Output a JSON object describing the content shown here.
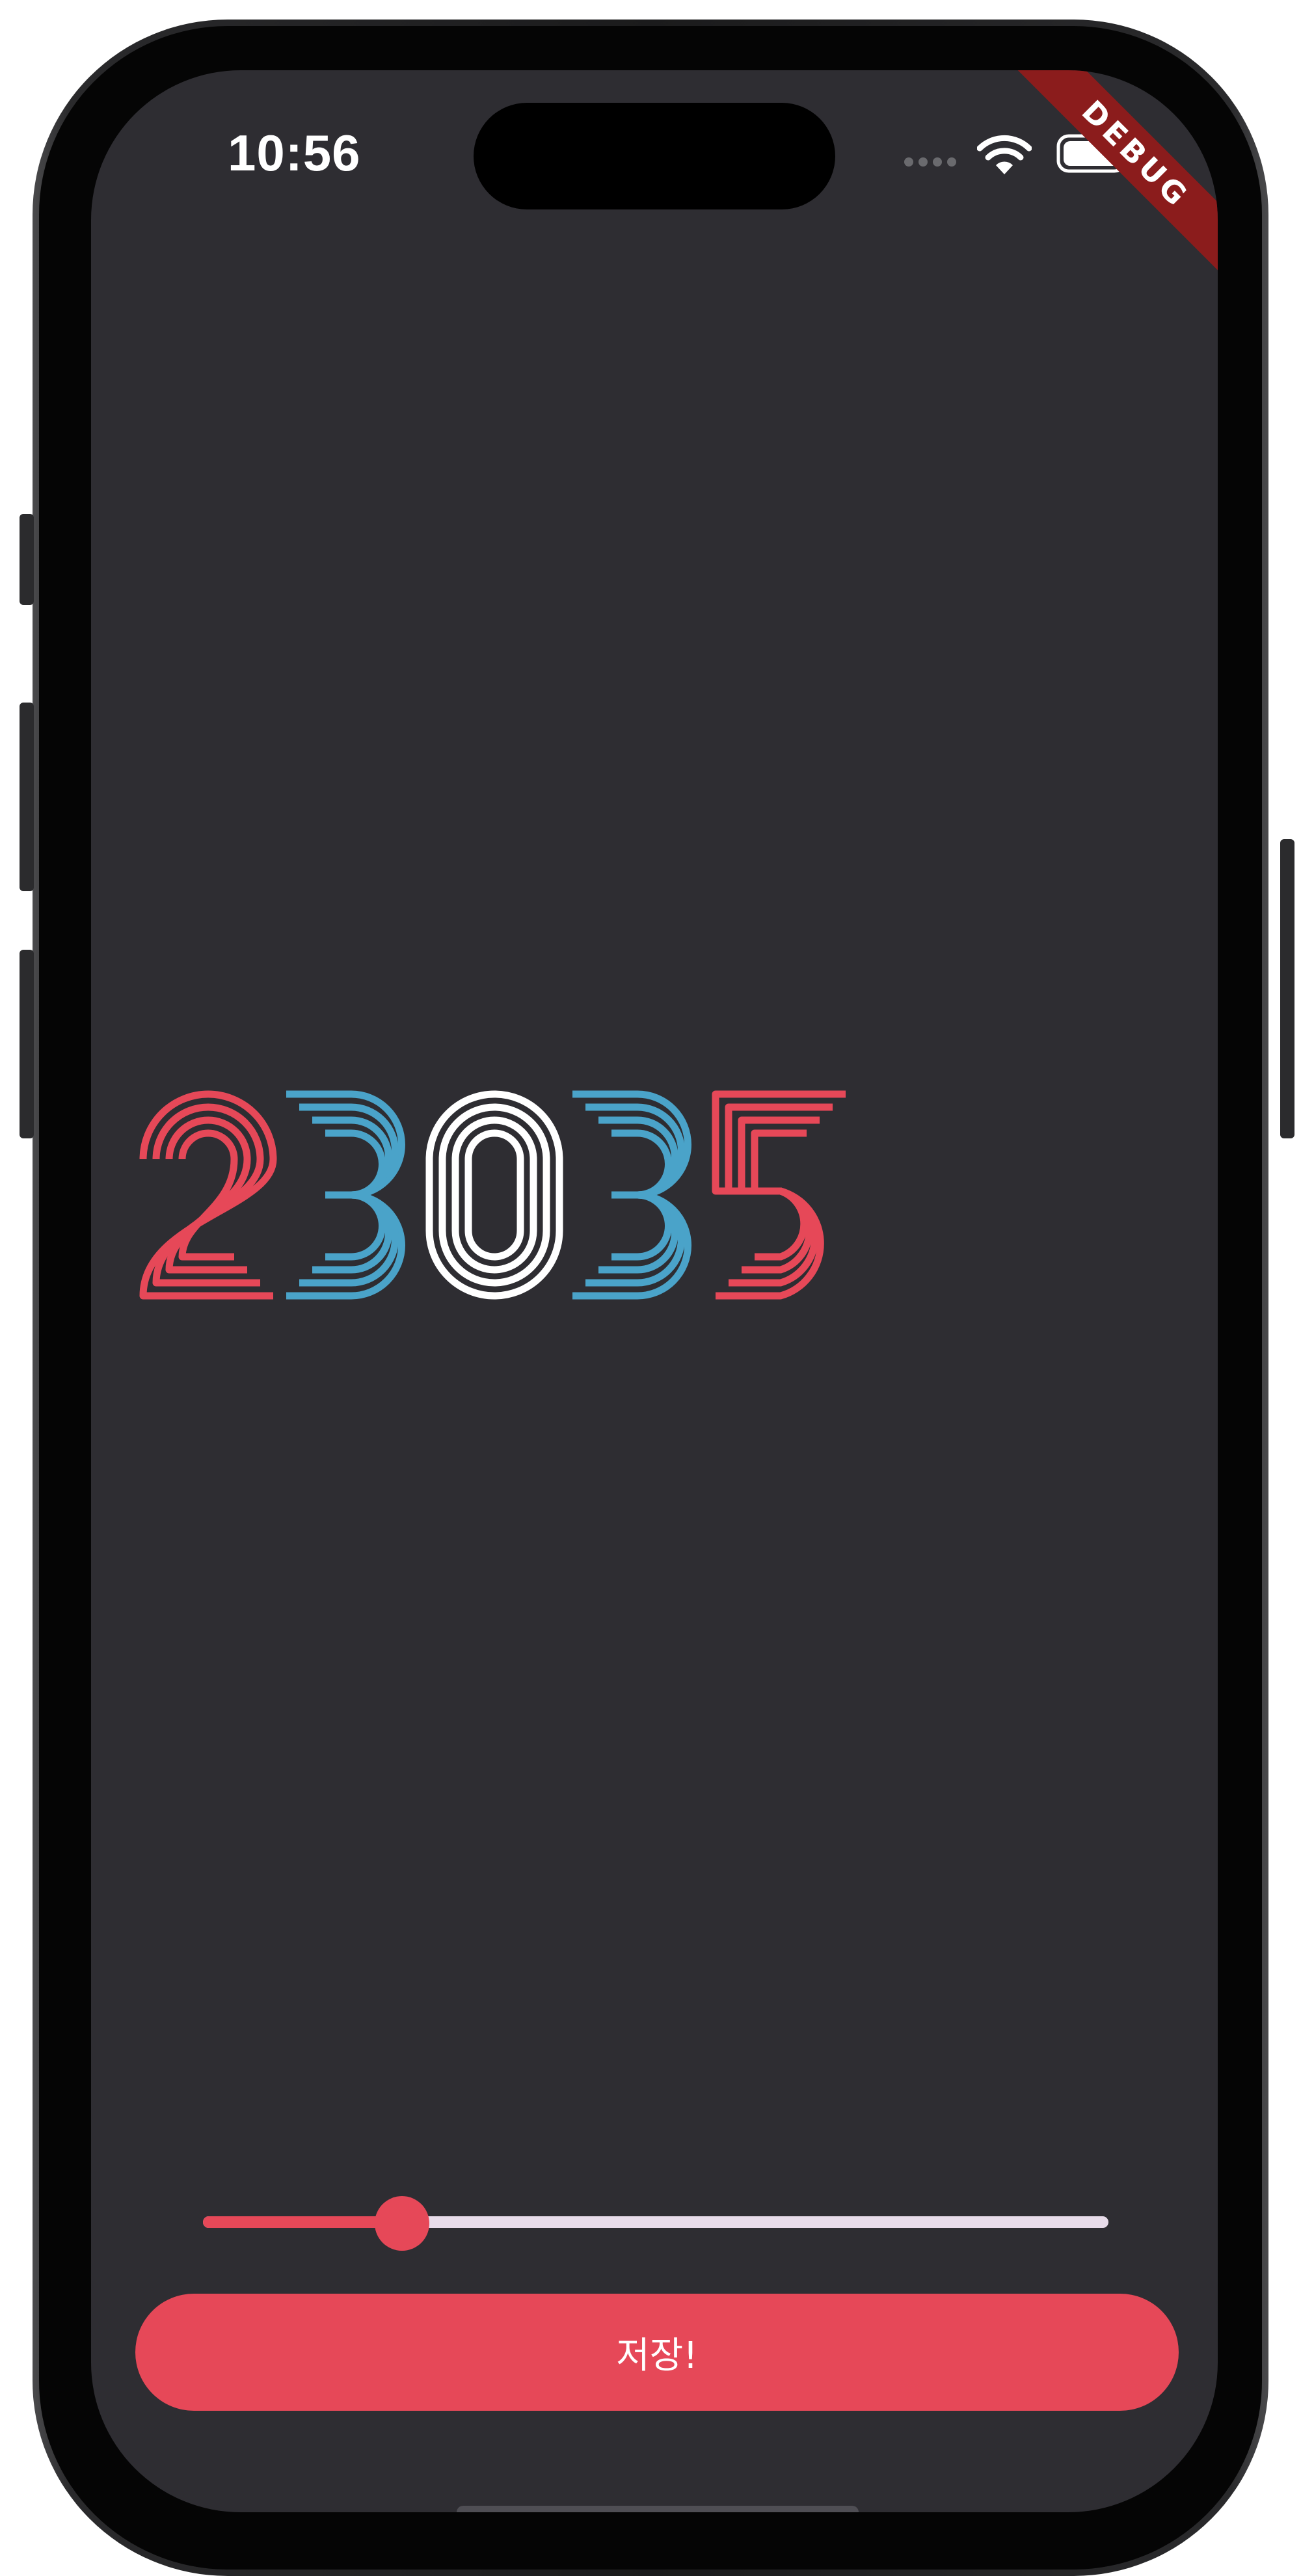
{
  "status_bar": {
    "time": "10:56",
    "wifi_icon": "wifi-icon",
    "battery_icon": "battery-icon",
    "signal_icon": "signal-dots-icon"
  },
  "debug_banner": {
    "label": "DEBUG",
    "color": "#8b1c1c"
  },
  "number_display": {
    "value": "23035",
    "digits": [
      "2",
      "3",
      "0",
      "3",
      "5"
    ],
    "digit_colors": [
      "#e64858",
      "#4aa3c9",
      "#ffffff",
      "#4aa3c9",
      "#e64858"
    ]
  },
  "slider": {
    "value_fraction": 0.22
  },
  "save_button": {
    "label": "저장!"
  },
  "colors": {
    "background": "#2e2d32",
    "accent": "#e64858",
    "secondary": "#4aa3c9",
    "track_inactive": "#e8dcea"
  }
}
